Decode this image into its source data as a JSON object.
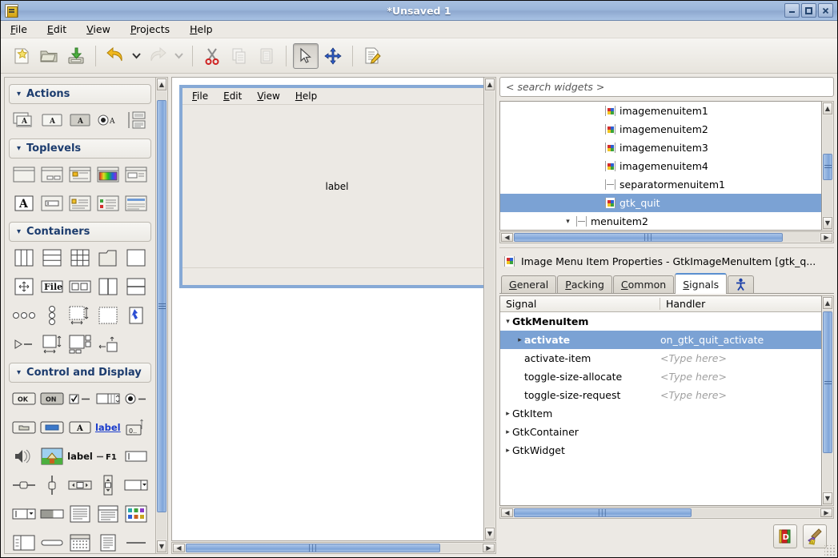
{
  "window": {
    "title": "*Unsaved 1",
    "icon": "glade-icon",
    "buttons": [
      {
        "name": "minimize-button",
        "glyph": "minimize-icon"
      },
      {
        "name": "maximize-button",
        "glyph": "maximize-icon"
      },
      {
        "name": "close-button",
        "glyph": "close-icon"
      }
    ]
  },
  "menubar": {
    "items": [
      {
        "label": "File",
        "mnemonic": "F"
      },
      {
        "label": "Edit",
        "mnemonic": "E"
      },
      {
        "label": "View",
        "mnemonic": "V"
      },
      {
        "label": "Projects",
        "mnemonic": "P"
      },
      {
        "label": "Help",
        "mnemonic": "H"
      }
    ]
  },
  "toolbar": {
    "items": [
      {
        "name": "new-button",
        "icon": "new-document-icon",
        "state": "normal"
      },
      {
        "name": "open-button",
        "icon": "open-folder-icon",
        "state": "normal"
      },
      {
        "name": "save-button",
        "icon": "save-disk-icon",
        "state": "normal"
      },
      {
        "name": "separator-1",
        "icon": "separator",
        "state": "normal"
      },
      {
        "name": "undo-button",
        "icon": "undo-arrow-icon",
        "state": "normal"
      },
      {
        "name": "undo-dropdown",
        "icon": "chevron-down-icon",
        "state": "normal"
      },
      {
        "name": "redo-button",
        "icon": "redo-arrow-icon",
        "state": "disabled"
      },
      {
        "name": "redo-dropdown",
        "icon": "chevron-down-icon",
        "state": "disabled"
      },
      {
        "name": "separator-2",
        "icon": "separator",
        "state": "normal"
      },
      {
        "name": "cut-button",
        "icon": "scissors-icon",
        "state": "normal"
      },
      {
        "name": "copy-button",
        "icon": "copy-icon",
        "state": "disabled"
      },
      {
        "name": "paste-button",
        "icon": "clipboard-icon",
        "state": "disabled"
      },
      {
        "name": "separator-3",
        "icon": "separator",
        "state": "normal"
      },
      {
        "name": "select-pointer-button",
        "icon": "cursor-arrow-icon",
        "state": "pressed"
      },
      {
        "name": "drag-resize-button",
        "icon": "move-arrows-icon",
        "state": "normal"
      },
      {
        "name": "separator-4",
        "icon": "separator",
        "state": "normal"
      },
      {
        "name": "edit-properties-button",
        "icon": "document-pencil-icon",
        "state": "normal"
      }
    ]
  },
  "palette": {
    "sections": [
      {
        "name": "actions",
        "label": "Actions",
        "expanded": true,
        "items": [
          {
            "name": "action-group-icon",
            "label": "GtkActionGroup"
          },
          {
            "name": "action-icon",
            "label": "GtkAction"
          },
          {
            "name": "toggle-action-icon",
            "label": "GtkToggleAction"
          },
          {
            "name": "radio-action-icon",
            "label": "GtkRadioAction"
          },
          {
            "name": "recent-action-icon",
            "label": "GtkRecentAction"
          }
        ]
      },
      {
        "name": "toplevels",
        "label": "Toplevels",
        "expanded": true,
        "items": [
          {
            "name": "window-icon",
            "label": "GtkWindow"
          },
          {
            "name": "dialog-icon",
            "label": "GtkDialog"
          },
          {
            "name": "message-dialog-icon",
            "label": "GtkMessageDialog"
          },
          {
            "name": "color-selection-dialog-icon",
            "label": "GtkColorSelectionDialog"
          },
          {
            "name": "file-chooser-dialog-icon",
            "label": "GtkFileChooserDialog"
          },
          {
            "name": "font-selection-dialog-icon",
            "label": "GtkFontSelectionDialog"
          },
          {
            "name": "input-dialog-icon",
            "label": "GtkInputDialog"
          },
          {
            "name": "about-dialog-icon",
            "label": "GtkAboutDialog"
          },
          {
            "name": "assistant-icon",
            "label": "GtkAssistant"
          },
          {
            "name": "offscreen-window-icon",
            "label": "GtkOffscreenWindow"
          }
        ]
      },
      {
        "name": "containers",
        "label": "Containers",
        "expanded": true,
        "items": [
          {
            "name": "hbox-icon",
            "label": "GtkHBox"
          },
          {
            "name": "vbox-icon",
            "label": "GtkVBox"
          },
          {
            "name": "table-icon",
            "label": "GtkTable"
          },
          {
            "name": "notebook-icon",
            "label": "GtkNotebook"
          },
          {
            "name": "frame-icon",
            "label": "GtkFrame"
          },
          {
            "name": "alignment-icon",
            "label": "GtkAlignment"
          },
          {
            "name": "file-chooser-widget-icon",
            "label": "GtkFileChooserWidget"
          },
          {
            "name": "hbutton-box-icon",
            "label": "GtkHButtonBox"
          },
          {
            "name": "hpaned-icon",
            "label": "GtkHPaned"
          },
          {
            "name": "vpaned-icon",
            "label": "GtkVPaned"
          },
          {
            "name": "hbutton-row-icon",
            "label": "GtkVButtonBox"
          },
          {
            "name": "vbutton-column-icon",
            "label": "GtkVButtonBox"
          },
          {
            "name": "scrolled-window-icon",
            "label": "GtkScrolledWindow"
          },
          {
            "name": "viewport-icon",
            "label": "GtkViewport"
          },
          {
            "name": "event-box-icon",
            "label": "GtkEventBox"
          },
          {
            "name": "expander-icon",
            "label": "GtkExpander"
          },
          {
            "name": "aspect-frame-icon",
            "label": "GtkAspectFrame"
          },
          {
            "name": "layout-icon",
            "label": "GtkLayout"
          },
          {
            "name": "fixed-icon",
            "label": "GtkFixed"
          }
        ]
      },
      {
        "name": "control-and-display",
        "label": "Control and Display",
        "expanded": true,
        "items": [
          {
            "name": "button-icon",
            "label": "GtkButton",
            "text": "OK"
          },
          {
            "name": "toggle-button-icon",
            "label": "GtkToggleButton",
            "text": "ON"
          },
          {
            "name": "check-button-icon",
            "label": "GtkCheckButton"
          },
          {
            "name": "spin-button-icon",
            "label": "GtkSpinButton"
          },
          {
            "name": "radio-button-icon",
            "label": "GtkRadioButton"
          },
          {
            "name": "file-chooser-button-icon",
            "label": "GtkFileChooserButton"
          },
          {
            "name": "color-button-icon",
            "label": "GtkColorButton"
          },
          {
            "name": "font-button-icon",
            "label": "GtkFontButton"
          },
          {
            "name": "link-button-icon",
            "label": "GtkLinkButton",
            "text": "label"
          },
          {
            "name": "scale-button-icon",
            "label": "GtkScaleButton"
          },
          {
            "name": "volume-button-icon",
            "label": "GtkVolumeButton"
          },
          {
            "name": "image-icon",
            "label": "GtkImage"
          },
          {
            "name": "label-icon",
            "label": "GtkLabel",
            "text": "label"
          },
          {
            "name": "accel-label-icon",
            "label": "GtkAccelLabel",
            "text": "F1"
          },
          {
            "name": "entry-icon",
            "label": "GtkEntry"
          },
          {
            "name": "hscale-icon",
            "label": "GtkHScale"
          },
          {
            "name": "vscale-icon",
            "label": "GtkVScale"
          },
          {
            "name": "hscrollbar-icon",
            "label": "GtkHScrollbar"
          },
          {
            "name": "vscrollbar-icon",
            "label": "GtkVScrollbar"
          },
          {
            "name": "combo-box-icon",
            "label": "GtkComboBox"
          },
          {
            "name": "combo-box-entry-icon",
            "label": "GtkComboBoxEntry"
          },
          {
            "name": "progress-bar-icon",
            "label": "GtkProgressBar"
          },
          {
            "name": "text-view-icon",
            "label": "GtkTextView"
          },
          {
            "name": "tree-view-icon",
            "label": "GtkTreeView"
          },
          {
            "name": "icon-view-icon",
            "label": "GtkIconView"
          },
          {
            "name": "list-store-icon",
            "label": "GtkListStore"
          },
          {
            "name": "hseparator-icon",
            "label": "GtkHSeparator"
          },
          {
            "name": "calendar-icon",
            "label": "GtkCalendar"
          },
          {
            "name": "statusbar-icon",
            "label": "GtkStatusbar"
          },
          {
            "name": "separator-line-icon",
            "label": "GtkSeparator"
          }
        ]
      }
    ],
    "scrollbar": {
      "name": "palette-vscrollbar",
      "thumb_top_pct": 4,
      "thumb_height_pct": 88
    }
  },
  "canvas": {
    "design_window": {
      "name": "design-window",
      "menubar": [
        {
          "label": "File",
          "mnemonic": "F"
        },
        {
          "label": "Edit",
          "mnemonic": "E"
        },
        {
          "label": "View",
          "mnemonic": "V"
        },
        {
          "label": "Help",
          "mnemonic": "H"
        }
      ],
      "content_label": "label",
      "selected": true
    },
    "vscrollbar": {
      "name": "canvas-vscrollbar"
    },
    "hscrollbar": {
      "name": "canvas-hscrollbar",
      "thumb_left_pct": 1,
      "thumb_width_pct": 86
    }
  },
  "search": {
    "name": "search-widgets-input",
    "placeholder": "< search widgets >",
    "value": "< search widgets >"
  },
  "tree": {
    "name": "widget-tree",
    "nodes": [
      {
        "label": "imagemenuitem1",
        "icon": "image-menu-item-icon",
        "indent": 4,
        "expander": "none",
        "selected": false
      },
      {
        "label": "imagemenuitem2",
        "icon": "image-menu-item-icon",
        "indent": 4,
        "expander": "none",
        "selected": false
      },
      {
        "label": "imagemenuitem3",
        "icon": "image-menu-item-icon",
        "indent": 4,
        "expander": "none",
        "selected": false
      },
      {
        "label": "imagemenuitem4",
        "icon": "image-menu-item-icon",
        "indent": 4,
        "expander": "none",
        "selected": false
      },
      {
        "label": "separatormenuitem1",
        "icon": "separator-menu-item-icon",
        "indent": 4,
        "expander": "none",
        "selected": false
      },
      {
        "label": "gtk_quit",
        "icon": "image-menu-item-icon",
        "indent": 4,
        "expander": "none",
        "selected": true
      },
      {
        "label": "menuitem2",
        "icon": "separator-menu-item-icon",
        "indent": 3,
        "expander": "expanded",
        "selected": false
      }
    ],
    "vscrollbar": {
      "name": "tree-vscrollbar",
      "thumb_top_pct": 38,
      "thumb_height_pct": 26
    },
    "hscrollbar": {
      "name": "tree-hscrollbar",
      "thumb_left_pct": 1,
      "thumb_width_pct": 88
    }
  },
  "properties": {
    "title": "Image Menu Item Properties - GtkImageMenuItem [gtk_q...",
    "title_icon": "image-menu-item-icon",
    "tabs": [
      {
        "name": "tab-general",
        "label": "General",
        "mnemonic": "G",
        "active": false
      },
      {
        "name": "tab-packing",
        "label": "Packing",
        "mnemonic": "P",
        "active": false
      },
      {
        "name": "tab-common",
        "label": "Common",
        "mnemonic": "C",
        "active": false
      },
      {
        "name": "tab-signals",
        "label": "Signals",
        "mnemonic": "S",
        "active": true
      },
      {
        "name": "tab-accessibility",
        "label": "",
        "icon": "accessibility-icon",
        "active": false
      }
    ],
    "signals_table": {
      "columns": [
        "Signal",
        "Handler"
      ],
      "rows": [
        {
          "signal": "GtkMenuItem",
          "handler": "",
          "indent": 0,
          "expander": "expanded",
          "bold": true,
          "selected": false,
          "placeholder": false
        },
        {
          "signal": "activate",
          "handler": "on_gtk_quit_activate",
          "indent": 1,
          "expander": "collapsed",
          "bold": true,
          "selected": true,
          "placeholder": false
        },
        {
          "signal": "activate-item",
          "handler": "<Type here>",
          "indent": 1,
          "expander": "none",
          "bold": false,
          "selected": false,
          "placeholder": true
        },
        {
          "signal": "toggle-size-allocate",
          "handler": "<Type here>",
          "indent": 1,
          "expander": "none",
          "bold": false,
          "selected": false,
          "placeholder": true
        },
        {
          "signal": "toggle-size-request",
          "handler": "<Type here>",
          "indent": 1,
          "expander": "none",
          "bold": false,
          "selected": false,
          "placeholder": true
        },
        {
          "signal": "GtkItem",
          "handler": "",
          "indent": 0,
          "expander": "collapsed",
          "bold": false,
          "selected": false,
          "placeholder": false
        },
        {
          "signal": "GtkContainer",
          "handler": "",
          "indent": 0,
          "expander": "collapsed",
          "bold": false,
          "selected": false,
          "placeholder": false
        },
        {
          "signal": "GtkWidget",
          "handler": "",
          "indent": 0,
          "expander": "collapsed",
          "bold": false,
          "selected": false,
          "placeholder": false
        }
      ],
      "vscrollbar": {
        "name": "signals-vscrollbar",
        "thumb_top_pct": 2,
        "thumb_height_pct": 76
      },
      "hscrollbar": {
        "name": "signals-hscrollbar",
        "thumb_left_pct": 1,
        "thumb_width_pct": 57
      }
    },
    "actions": [
      {
        "name": "documentation-button",
        "icon": "devhelp-book-icon"
      },
      {
        "name": "clear-button",
        "icon": "broom-icon"
      }
    ]
  },
  "colors": {
    "selection_blue": "#7ba2d4",
    "titlebar_blue": "#9bb6da",
    "section_header_text": "#1c3c6e",
    "scrollbar_thumb": "#8fb0de",
    "design_window_outline": "#86a9d6"
  }
}
